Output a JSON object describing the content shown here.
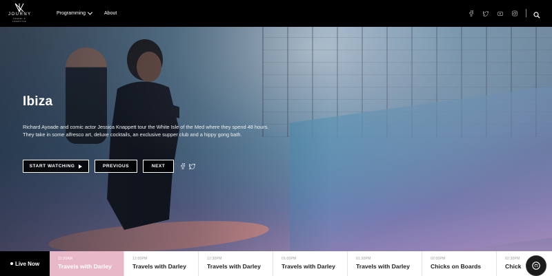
{
  "nav": {
    "logo_word": "JOURNY",
    "logo_sub": "TRAVEL & LIFESTYLE",
    "links": [
      {
        "label": "Programming",
        "has_dropdown": true
      },
      {
        "label": "About",
        "has_dropdown": false
      }
    ],
    "social_icons": [
      "facebook-icon",
      "twitter-icon",
      "youtube-icon",
      "instagram-icon"
    ],
    "search_icon": "search-icon"
  },
  "hero": {
    "title": "Ibiza",
    "description": "Richard Ayoade and comic actor Jessica Knappett tour the White Isle of the Med where they spend 48 hours. They take in some alfresco art, deluxe cocktails, an exclusive supper club and a hippy gong bath.",
    "buttons": {
      "watch": "START WATCHING",
      "previous": "PREVIOUS",
      "next": "NEXT"
    },
    "share_icons": [
      "facebook-icon",
      "twitter-icon"
    ]
  },
  "schedule": {
    "live_label": "Live Now",
    "slots": [
      {
        "time": "11:30AM",
        "title": "Travels with Darley",
        "current": true
      },
      {
        "time": "12:00PM",
        "title": "Travels with Darley",
        "current": false
      },
      {
        "time": "12:30PM",
        "title": "Travels with Darley",
        "current": false
      },
      {
        "time": "01:00PM",
        "title": "Travels with Darley",
        "current": false
      },
      {
        "time": "01:30PM",
        "title": "Travels with Darley",
        "current": false
      },
      {
        "time": "02:00PM",
        "title": "Chicks on Boards",
        "current": false
      },
      {
        "time": "02:30PM",
        "title": "Chick",
        "current": false
      }
    ]
  },
  "colors": {
    "accent_pink": "#e8b8c8",
    "nav_bg": "#000000",
    "schedule_bg": "#ffffff"
  }
}
